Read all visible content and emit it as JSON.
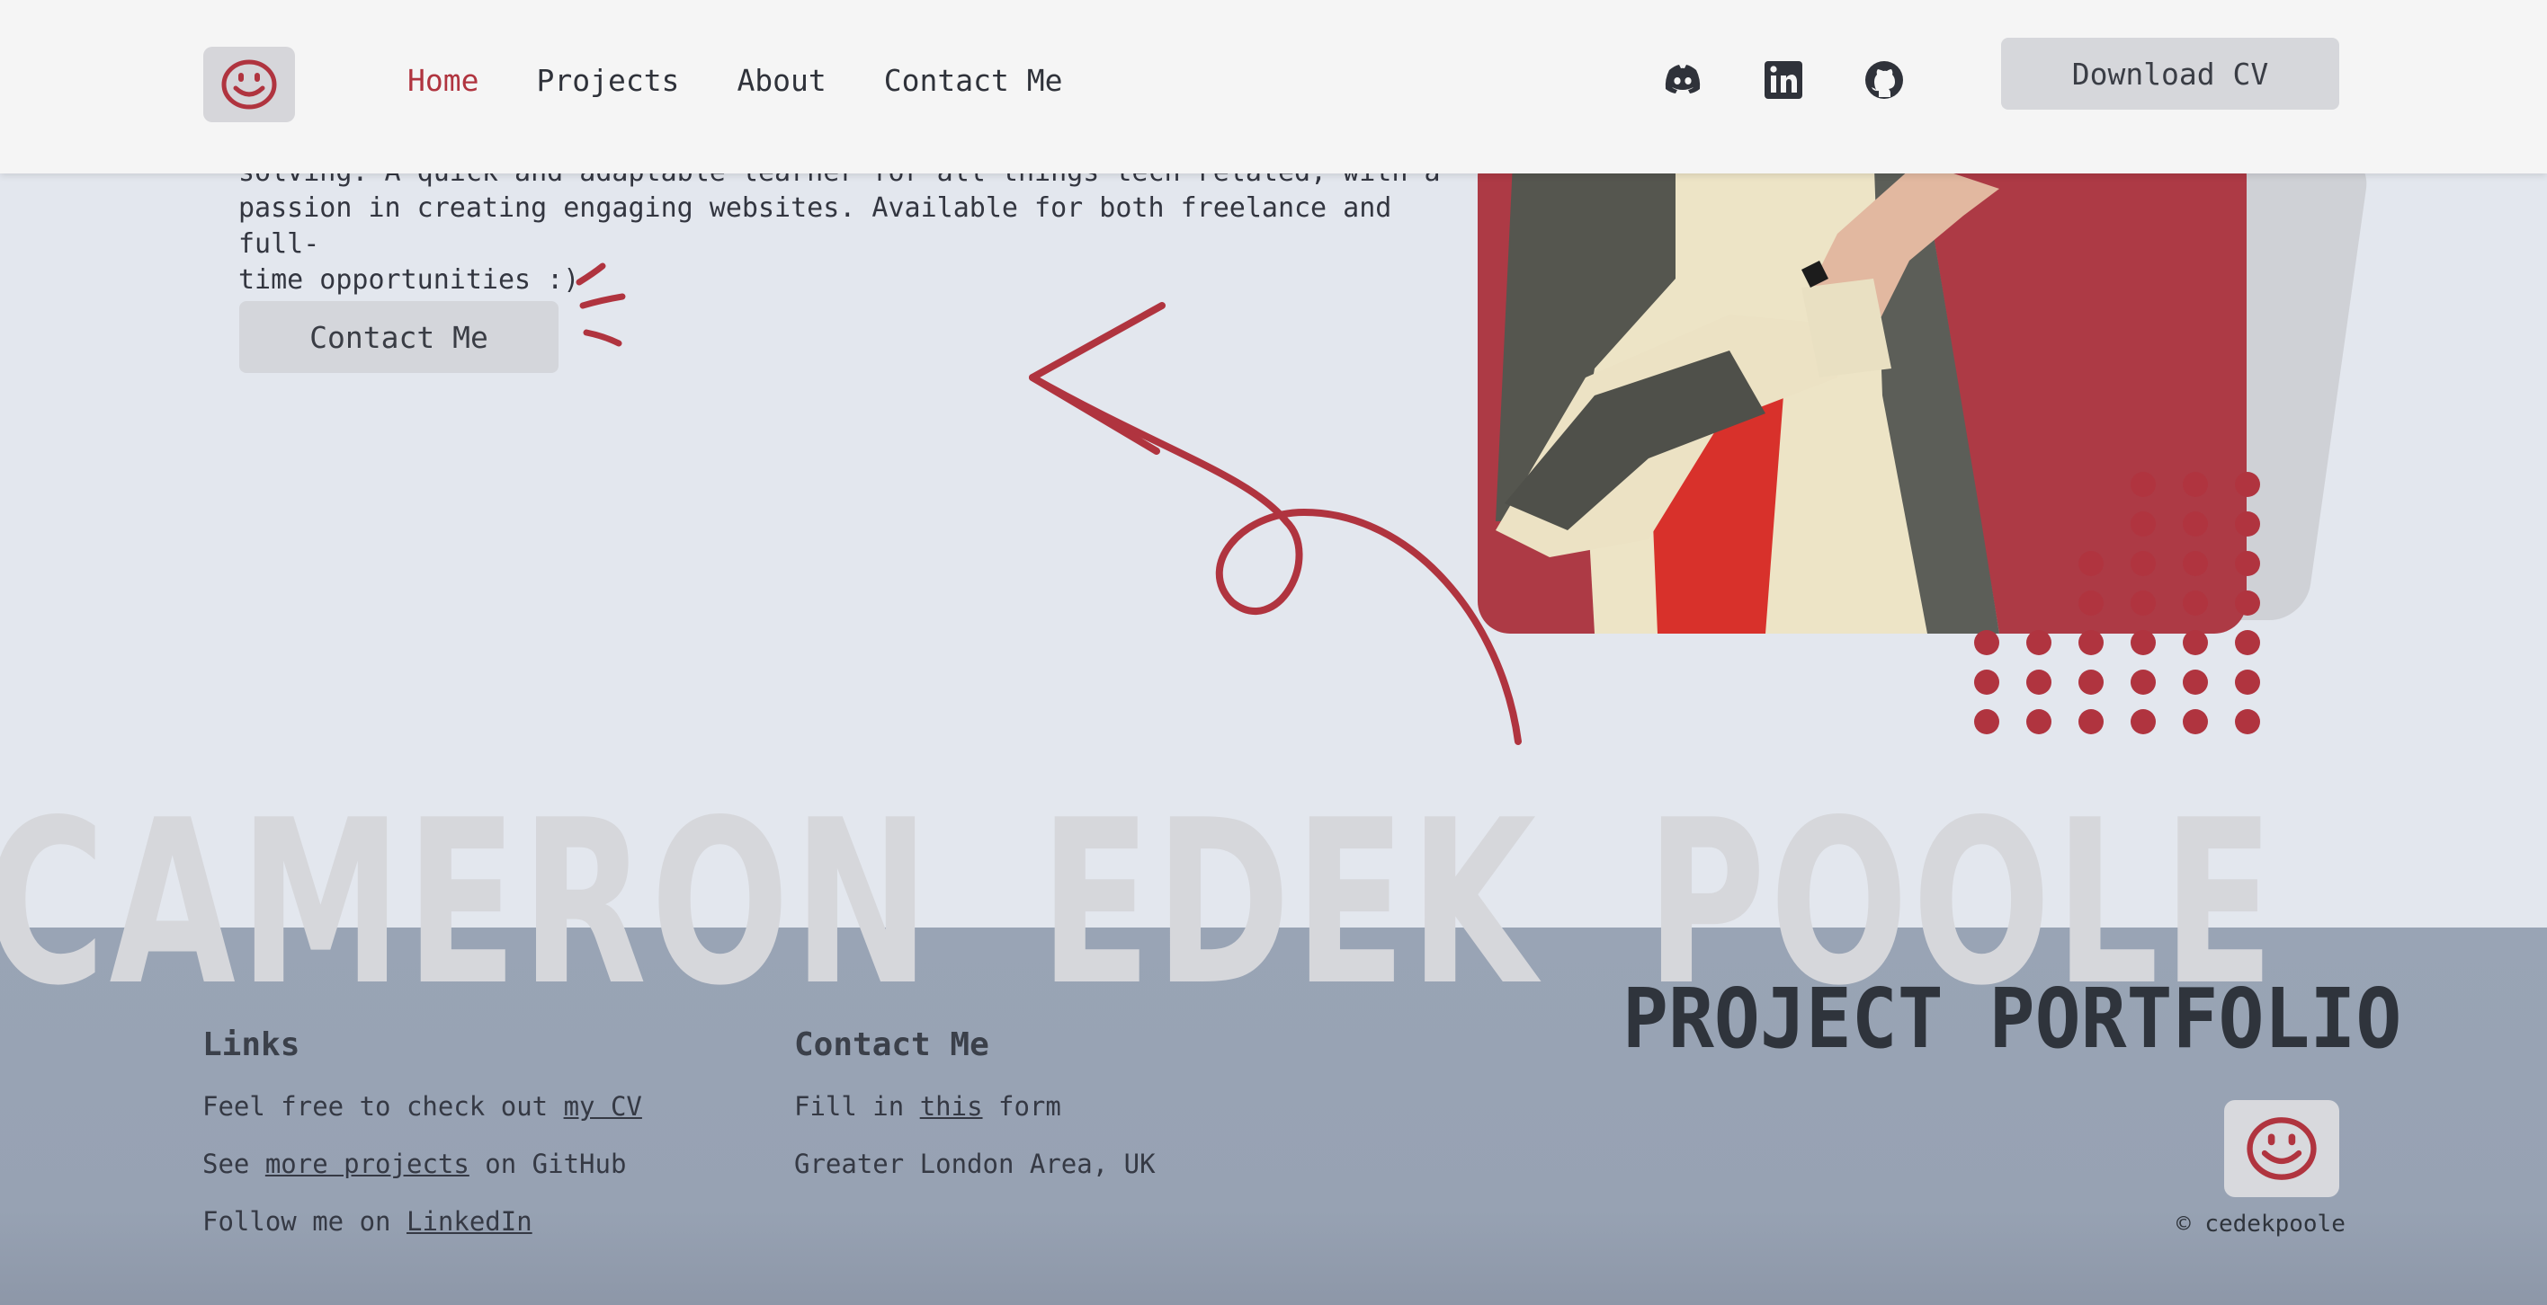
{
  "header": {
    "nav": [
      "Home",
      "Projects",
      "About",
      "Contact Me"
    ],
    "active_nav": "Home",
    "download_cv": "Download CV",
    "socials": [
      "discord-icon",
      "linkedin-icon",
      "github-icon"
    ]
  },
  "hero": {
    "intro_line1": "solving. A quick and adaptable learner for all things tech related, with a",
    "intro_line2": "passion in creating engaging websites. Available for both freelance and full-",
    "intro_line3": "time opportunities :)",
    "contact_button": "Contact Me"
  },
  "banner": {
    "name_word1": "CAMERON",
    "name_word2": "EDEK",
    "name_word3": "POOLE",
    "subtitle": "PROJECT PORTFOLIO"
  },
  "footer": {
    "links_title": "Links",
    "links": [
      {
        "before": "Feel free to check out ",
        "link": "my CV",
        "after": ""
      },
      {
        "before": "See ",
        "link": "more projects",
        "after": " on GitHub"
      },
      {
        "before": "Follow me on ",
        "link": "LinkedIn",
        "after": ""
      }
    ],
    "contact_title": "Contact Me",
    "contact_before": "Fill in ",
    "contact_link": "this",
    "contact_after": " form",
    "location": "Greater London Area, UK",
    "copyright": "cedekpoole"
  },
  "colors": {
    "accent": "#b0343f",
    "header_bg": "#f5f5f5",
    "page_bg": "#e3e7ee",
    "footer_bg": "#99a4b5"
  }
}
